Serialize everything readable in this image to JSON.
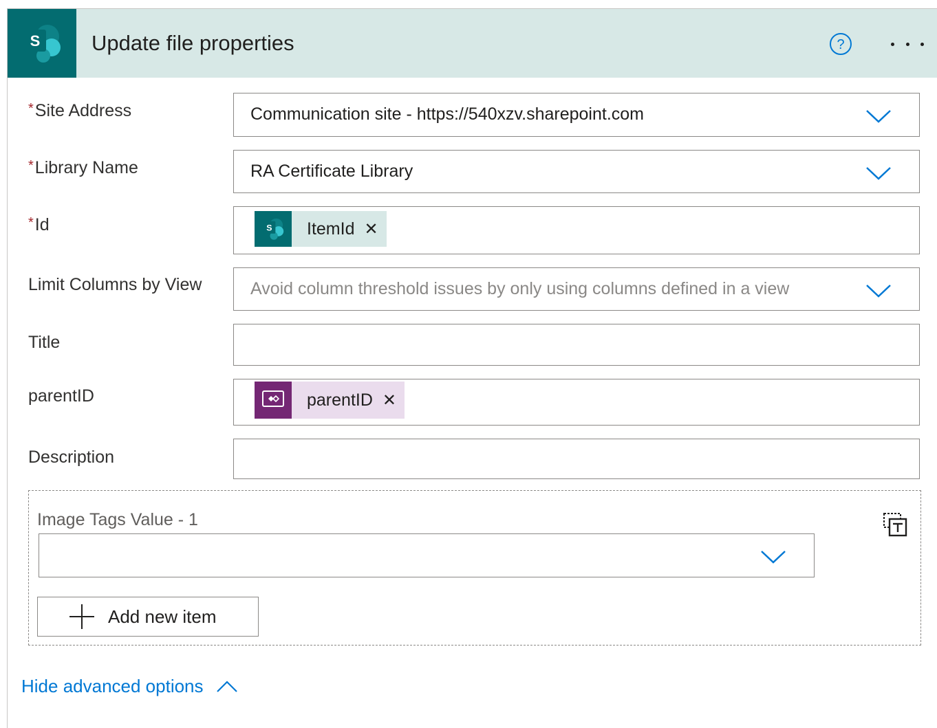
{
  "header": {
    "title": "Update file properties",
    "icon": "sharepoint-icon",
    "help_icon": "help-icon",
    "more_icon": "more-options-icon",
    "background": "#d7e8e6",
    "logo_color": "#036c70"
  },
  "fields": {
    "site_address": {
      "label": "Site Address",
      "required": "*",
      "value": "Communication site - https://540xzv.sharepoint.com"
    },
    "library_name": {
      "label": "Library Name",
      "required": "*",
      "value": "RA Certificate Library"
    },
    "id": {
      "label": "Id",
      "required": "*",
      "token": {
        "label": "ItemId",
        "icon": "sharepoint-icon",
        "color": "#036c70",
        "background": "#d7e8e6"
      }
    },
    "limit_columns": {
      "label": "Limit Columns by View",
      "placeholder": "Avoid column threshold issues by only using columns defined in a view"
    },
    "title": {
      "label": "Title",
      "value": ""
    },
    "parent_id": {
      "label": "parentID",
      "token": {
        "label": "parentID",
        "icon": "power-apps-icon",
        "color": "#742774",
        "background": "#eadced"
      }
    },
    "description": {
      "label": "Description",
      "value": ""
    }
  },
  "array": {
    "label": "Image Tags Value - 1",
    "remove_icon": "remove-item-icon",
    "add_label": "Add new item"
  },
  "advanced": {
    "label": "Hide advanced options",
    "color": "#0078d4"
  }
}
